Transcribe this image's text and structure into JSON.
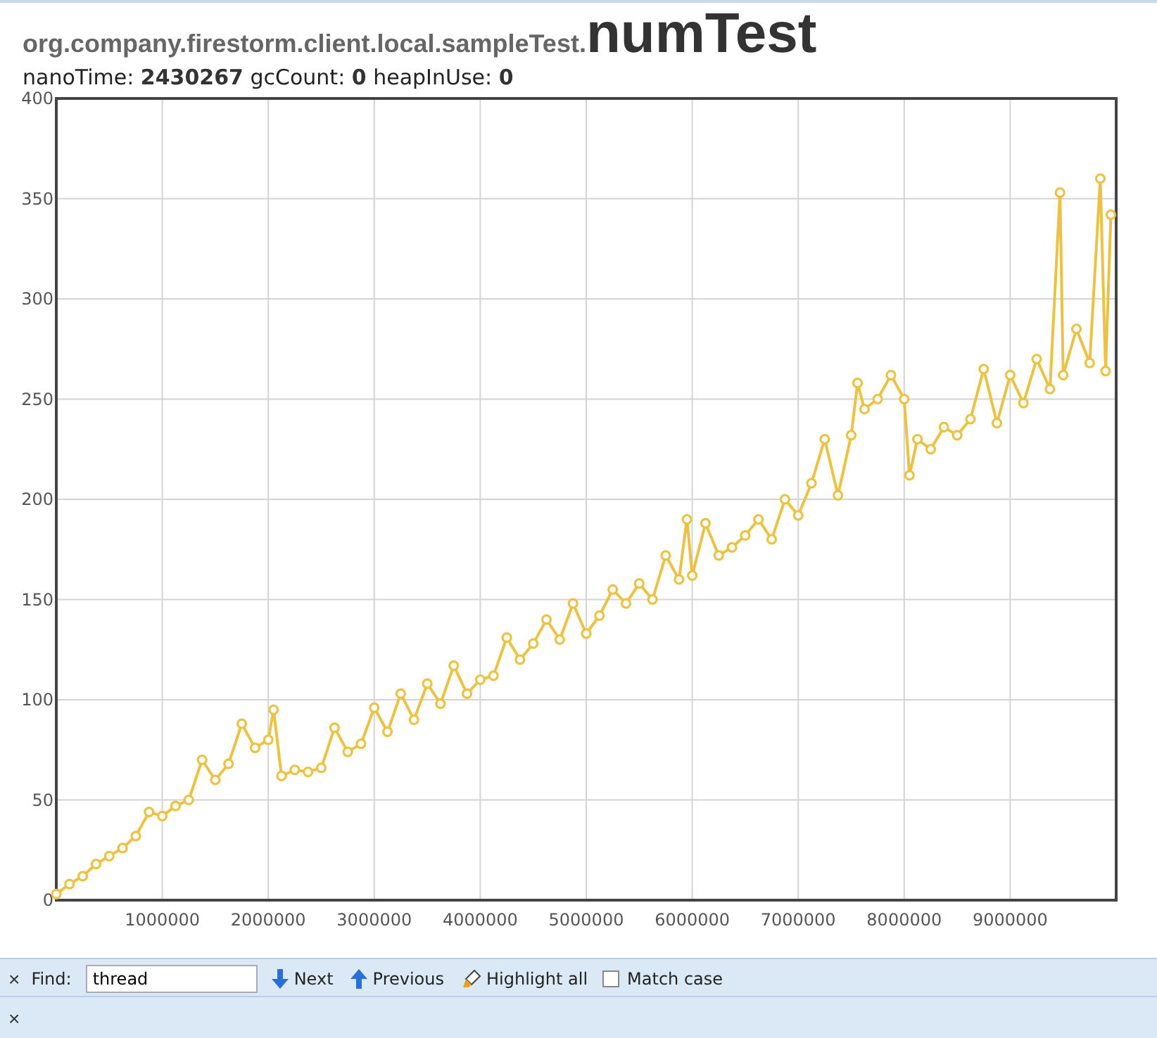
{
  "header": {
    "package": "org.company.firestorm.client.local.sampleTest.",
    "name": "numTest"
  },
  "stats": "nanoTime: **2430267** gcCount: **0** heapInUse: **0**",
  "chart_data": {
    "type": "line",
    "grid": true,
    "xlim": [
      0,
      10000000
    ],
    "ylim": [
      0,
      400
    ],
    "xticks": [
      1000000,
      2000000,
      3000000,
      4000000,
      5000000,
      6000000,
      7000000,
      8000000,
      9000000
    ],
    "yticks": [
      0,
      50,
      100,
      150,
      200,
      250,
      300,
      350,
      400
    ],
    "x": [
      0,
      125000,
      250000,
      375000,
      500000,
      625000,
      750000,
      875000,
      1000000,
      1125000,
      1250000,
      1375000,
      1500000,
      1625000,
      1750000,
      1875000,
      2000000,
      2050000,
      2125000,
      2250000,
      2375000,
      2500000,
      2625000,
      2750000,
      2875000,
      3000000,
      3125000,
      3250000,
      3375000,
      3500000,
      3625000,
      3750000,
      3875000,
      4000000,
      4125000,
      4250000,
      4375000,
      4500000,
      4625000,
      4750000,
      4875000,
      5000000,
      5125000,
      5250000,
      5375000,
      5500000,
      5625000,
      5750000,
      5875000,
      5950000,
      6000000,
      6125000,
      6250000,
      6375000,
      6500000,
      6625000,
      6750000,
      6875000,
      7000000,
      7125000,
      7250000,
      7375000,
      7500000,
      7560000,
      7625000,
      7750000,
      7875000,
      8000000,
      8050000,
      8125000,
      8250000,
      8375000,
      8500000,
      8625000,
      8750000,
      8875000,
      9000000,
      9125000,
      9250000,
      9375000,
      9470000,
      9500000,
      9625000,
      9750000,
      9850000,
      9900000,
      9950000
    ],
    "series": [
      {
        "color": "#ecc244",
        "marker": true,
        "values": [
          3,
          8,
          12,
          18,
          22,
          26,
          32,
          44,
          42,
          47,
          50,
          70,
          60,
          68,
          88,
          76,
          80,
          95,
          62,
          65,
          64,
          66,
          86,
          74,
          78,
          96,
          84,
          103,
          90,
          108,
          98,
          117,
          103,
          110,
          112,
          131,
          120,
          128,
          140,
          130,
          148,
          133,
          142,
          155,
          148,
          158,
          150,
          172,
          160,
          190,
          162,
          188,
          172,
          176,
          182,
          190,
          180,
          200,
          192,
          208,
          230,
          202,
          232,
          258,
          245,
          250,
          262,
          250,
          212,
          230,
          225,
          236,
          232,
          240,
          265,
          238,
          262,
          248,
          270,
          255,
          353,
          262,
          285,
          268,
          360,
          264,
          342
        ]
      }
    ]
  },
  "findbar": {
    "close": "×",
    "label": "Find:",
    "query": "thread",
    "next": "Next",
    "previous": "Previous",
    "highlight": "Highlight all",
    "match_case": {
      "label": "Match case",
      "checked": false
    }
  },
  "bottom_bar": {
    "close": "×"
  }
}
